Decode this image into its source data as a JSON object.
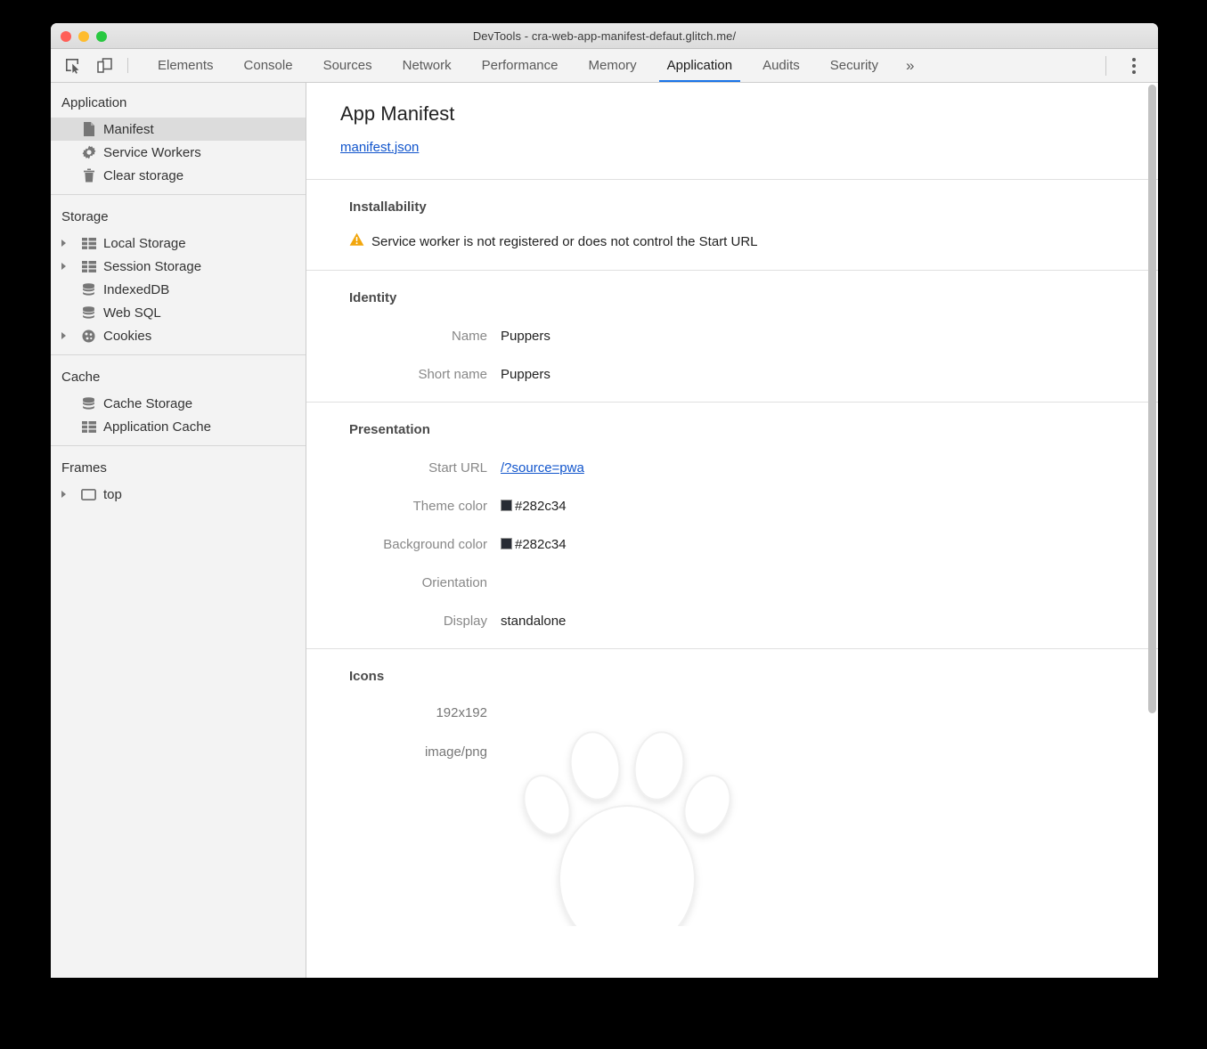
{
  "window": {
    "title": "DevTools - cra-web-app-manifest-defaut.glitch.me/",
    "traffic_lights": [
      "close",
      "minimize",
      "zoom"
    ]
  },
  "toolbar": {
    "inspect_icon": "inspect-element-icon",
    "device_icon": "device-toolbar-icon",
    "menu_icon": "kebab-menu-icon",
    "overflow_label": "»",
    "tabs": [
      {
        "label": "Elements",
        "active": false
      },
      {
        "label": "Console",
        "active": false
      },
      {
        "label": "Sources",
        "active": false
      },
      {
        "label": "Network",
        "active": false
      },
      {
        "label": "Performance",
        "active": false
      },
      {
        "label": "Memory",
        "active": false
      },
      {
        "label": "Application",
        "active": true
      },
      {
        "label": "Audits",
        "active": false
      },
      {
        "label": "Security",
        "active": false
      }
    ],
    "active_tab": "Application",
    "accent_color": "#1a73e8"
  },
  "sidebar": {
    "groups": [
      {
        "title": "Application",
        "items": [
          {
            "label": "Manifest",
            "icon": "document-icon",
            "selected": true,
            "expandable": false
          },
          {
            "label": "Service Workers",
            "icon": "gear-icon",
            "selected": false,
            "expandable": false
          },
          {
            "label": "Clear storage",
            "icon": "trash-icon",
            "selected": false,
            "expandable": false
          }
        ]
      },
      {
        "title": "Storage",
        "items": [
          {
            "label": "Local Storage",
            "icon": "table-icon",
            "selected": false,
            "expandable": true
          },
          {
            "label": "Session Storage",
            "icon": "table-icon",
            "selected": false,
            "expandable": true
          },
          {
            "label": "IndexedDB",
            "icon": "database-icon",
            "selected": false,
            "expandable": false
          },
          {
            "label": "Web SQL",
            "icon": "database-icon",
            "selected": false,
            "expandable": false
          },
          {
            "label": "Cookies",
            "icon": "cookie-icon",
            "selected": false,
            "expandable": true
          }
        ]
      },
      {
        "title": "Cache",
        "items": [
          {
            "label": "Cache Storage",
            "icon": "database-icon",
            "selected": false,
            "expandable": false
          },
          {
            "label": "Application Cache",
            "icon": "table-icon",
            "selected": false,
            "expandable": false
          }
        ]
      },
      {
        "title": "Frames",
        "items": [
          {
            "label": "top",
            "icon": "frame-icon",
            "selected": false,
            "expandable": true
          }
        ]
      }
    ]
  },
  "main": {
    "page_title": "App Manifest",
    "manifest_link": "manifest.json",
    "installability": {
      "heading": "Installability",
      "warning_icon": "warning-triangle-icon",
      "warning_color": "#f2a60c",
      "warning_text": "Service worker is not registered or does not control the Start URL"
    },
    "identity": {
      "heading": "Identity",
      "fields": [
        {
          "label": "Name",
          "value": "Puppers"
        },
        {
          "label": "Short name",
          "value": "Puppers"
        }
      ]
    },
    "presentation": {
      "heading": "Presentation",
      "start_url_label": "Start URL",
      "start_url_value": "/?source=pwa",
      "theme_color_label": "Theme color",
      "theme_color_value": "#282c34",
      "background_color_label": "Background color",
      "background_color_value": "#282c34",
      "orientation_label": "Orientation",
      "orientation_value": "",
      "display_label": "Display",
      "display_value": "standalone"
    },
    "icons": {
      "heading": "Icons",
      "size": "192x192",
      "mime": "image/png",
      "image_alt": "paw-print-icon"
    }
  }
}
